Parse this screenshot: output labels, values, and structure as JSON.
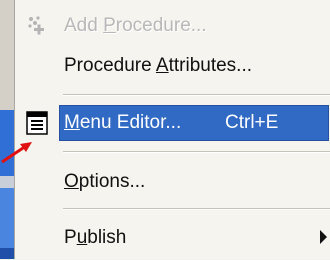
{
  "menu": {
    "items": [
      {
        "pre": "Add ",
        "acc": "P",
        "post": "rocedure...",
        "shortcut": "",
        "disabled": true,
        "selected": false,
        "icon": "add-procedure-icon",
        "submenu": false
      },
      {
        "pre": "Procedure ",
        "acc": "A",
        "post": "ttributes...",
        "shortcut": "",
        "disabled": false,
        "selected": false,
        "icon": "",
        "submenu": false
      },
      {
        "pre": "",
        "acc": "M",
        "post": "enu Editor...",
        "shortcut": "Ctrl+E",
        "disabled": false,
        "selected": true,
        "icon": "menu-editor-icon",
        "submenu": false
      },
      {
        "pre": "",
        "acc": "O",
        "post": "ptions...",
        "shortcut": "",
        "disabled": false,
        "selected": false,
        "icon": "",
        "submenu": false
      },
      {
        "pre": "P",
        "acc": "u",
        "post": "blish",
        "shortcut": "",
        "disabled": false,
        "selected": false,
        "icon": "",
        "submenu": true
      }
    ]
  },
  "colors": {
    "highlight": "#316ac5",
    "pointer": "#e01010"
  }
}
